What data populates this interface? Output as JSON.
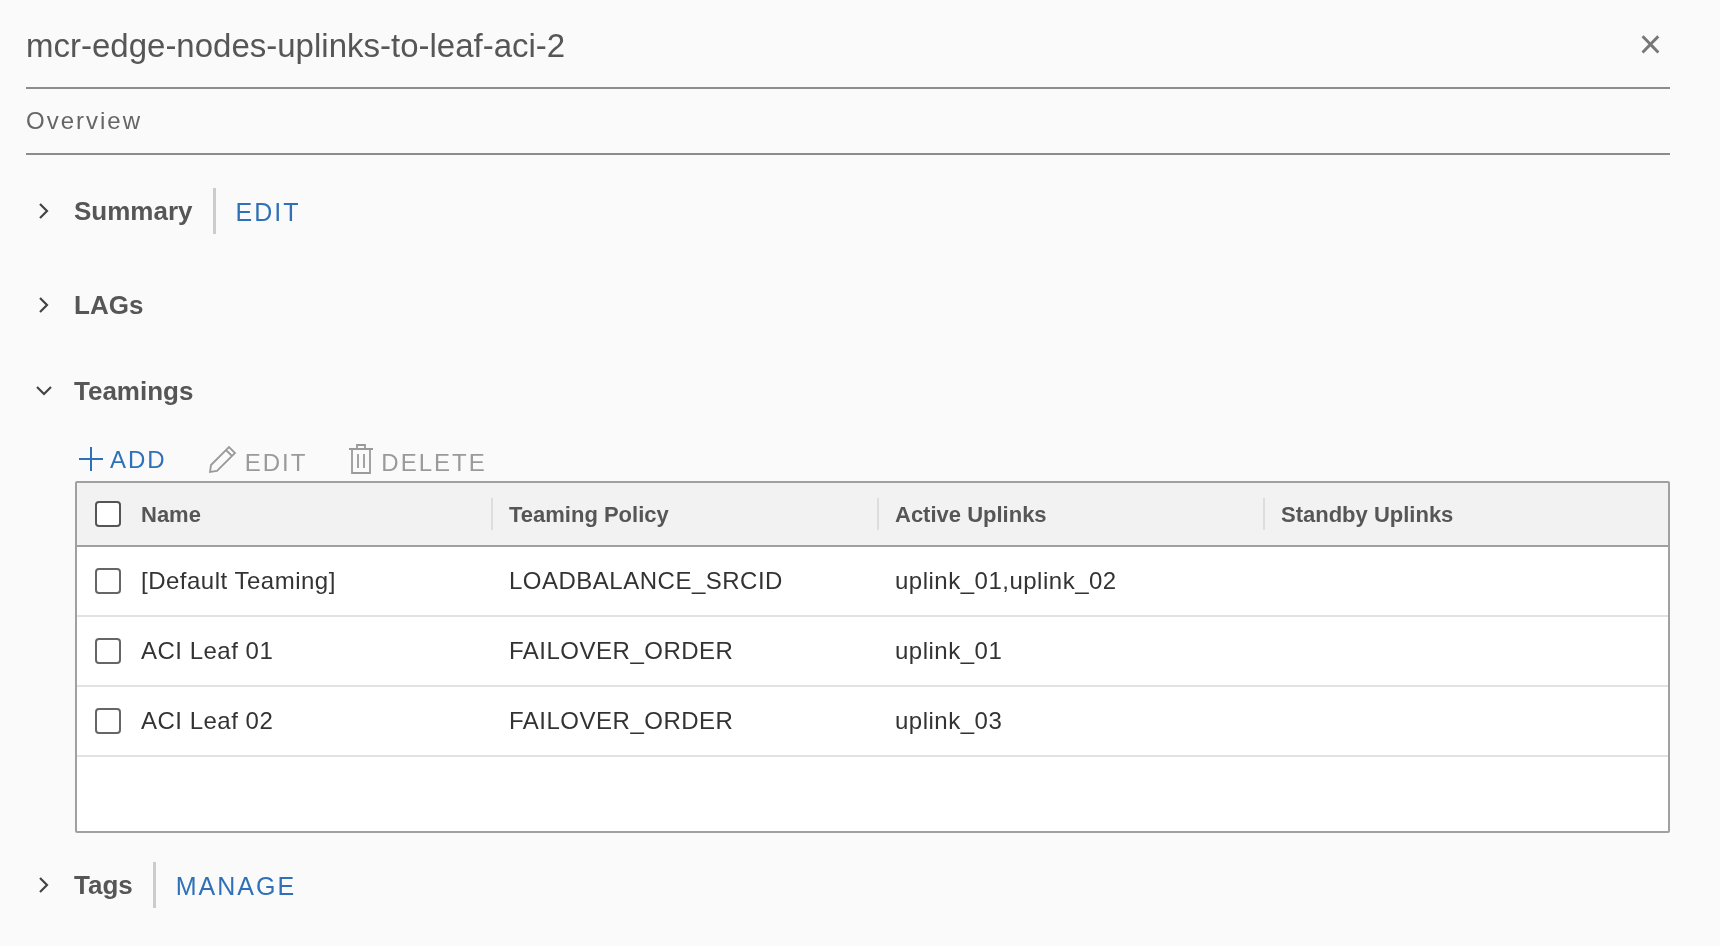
{
  "panel": {
    "title": "mcr-edge-nodes-uplinks-to-leaf-aci-2",
    "close": "×"
  },
  "tabs": [
    {
      "label": "Overview",
      "selected": true
    }
  ],
  "sections": [
    {
      "title": "Summary",
      "expanded": false,
      "action": "EDIT"
    },
    {
      "title": "LAGs",
      "expanded": false
    },
    {
      "title": "Teamings",
      "expanded": true,
      "toolbar": [
        {
          "kind": "add",
          "label": "ADD",
          "disabled": false
        },
        {
          "kind": "edit",
          "label": "EDIT",
          "disabled": true
        },
        {
          "kind": "delete",
          "label": "DELETE",
          "disabled": true
        }
      ],
      "table": {
        "select_all_checked": false,
        "columns": [
          "Name",
          "Teaming Policy",
          "Active Uplinks",
          "Standby Uplinks"
        ],
        "rows": [
          {
            "checked": false,
            "cells": [
              "[Default Teaming]",
              "LOADBALANCE_SRCID",
              "uplink_01,uplink_02",
              ""
            ]
          },
          {
            "checked": false,
            "cells": [
              "ACI Leaf 01",
              "FAILOVER_ORDER",
              "uplink_01",
              ""
            ]
          },
          {
            "checked": false,
            "cells": [
              "ACI Leaf 02",
              "FAILOVER_ORDER",
              "uplink_03",
              ""
            ]
          }
        ]
      }
    },
    {
      "title": "Tags",
      "expanded": false,
      "action": "MANAGE"
    }
  ]
}
